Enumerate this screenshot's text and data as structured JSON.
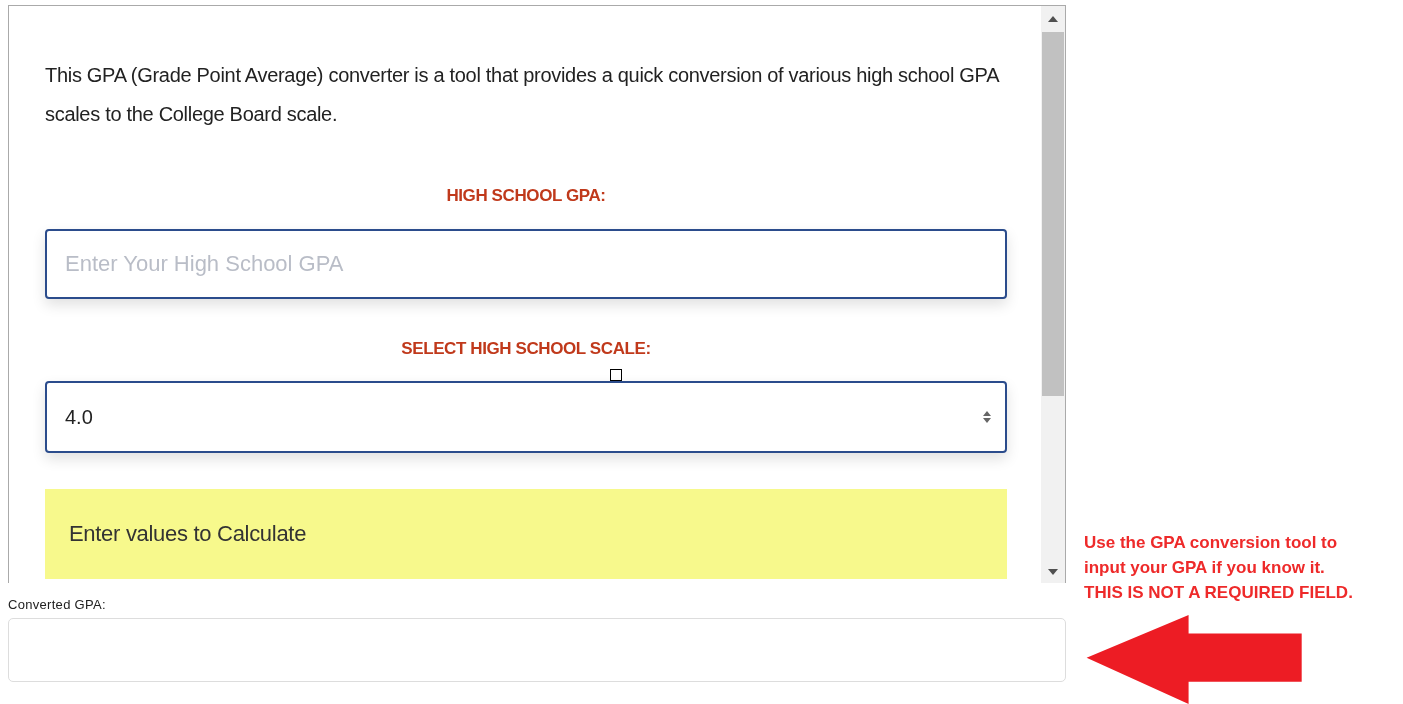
{
  "converter": {
    "intro": "This GPA (Grade Point Average) converter is a tool that provides a quick conversion of various high school GPA scales to the College Board scale.",
    "gpa_label": "HIGH SCHOOL GPA:",
    "gpa_field": {
      "placeholder": "Enter Your High School GPA"
    },
    "scale_label": "SELECT HIGH SCHOOL SCALE:",
    "scale_select": {
      "value": "4.0"
    },
    "result": "Enter values to Calculate"
  },
  "converted_gpa": {
    "label": "Converted GPA:"
  },
  "annotation": {
    "lines": [
      "Use the GPA conversion tool to",
      "input your GPA if you know it.",
      "THIS IS NOT A REQUIRED FIELD."
    ]
  }
}
